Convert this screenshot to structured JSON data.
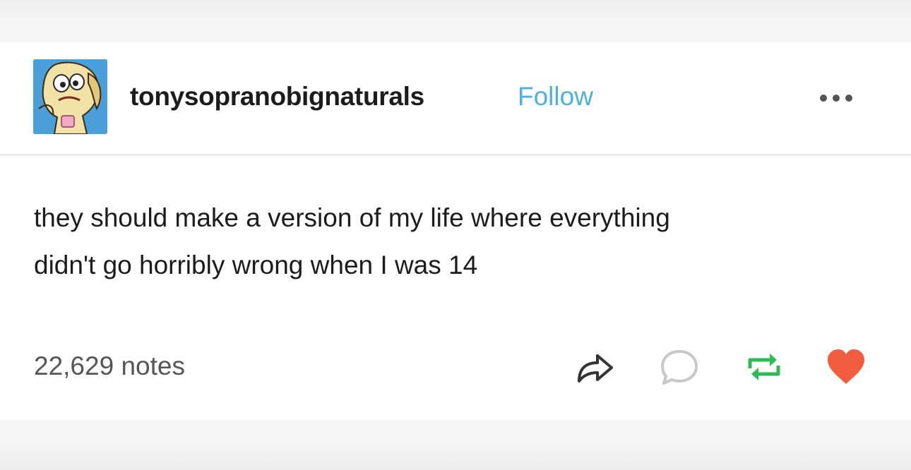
{
  "post": {
    "username": "tonysopranobignaturals",
    "follow_label": "Follow",
    "text_line1": "they should make a version of my life where everything",
    "text_line2": "didn't go horribly wrong when I was 14",
    "notes": "22,629 notes"
  },
  "icons": {
    "avatar": "cartoon-avatar",
    "more": "more-options-icon",
    "share": "share-icon",
    "reply": "reply-icon",
    "reblog": "reblog-icon",
    "like": "heart-icon"
  },
  "colors": {
    "follow": "#4fb0dc",
    "reblog": "#2dbb55",
    "like": "#f25d3e",
    "reply": "#cccccc",
    "share": "#333333"
  }
}
